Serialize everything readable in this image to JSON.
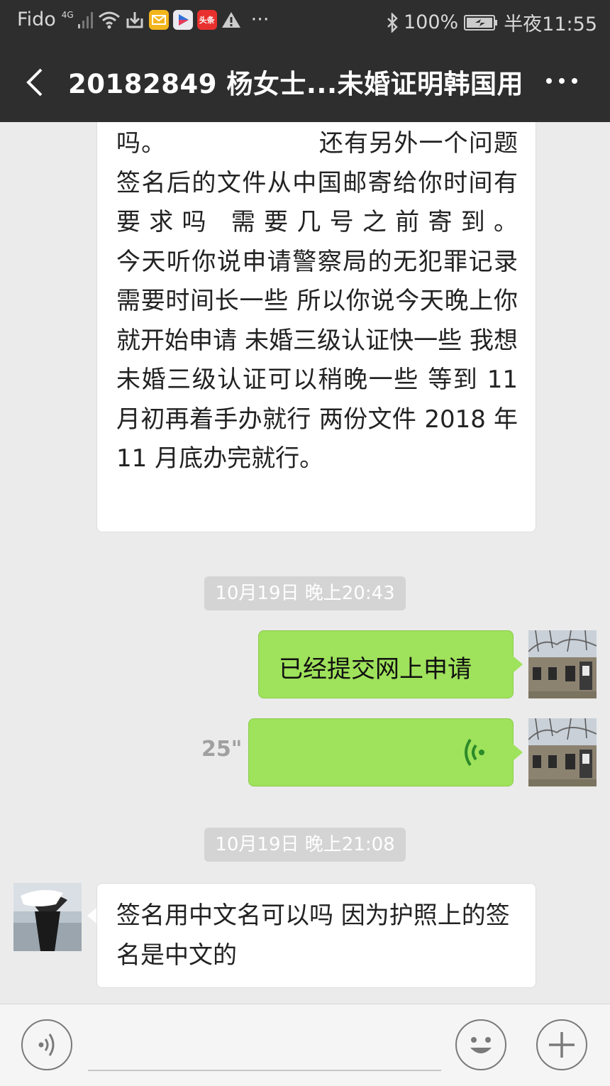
{
  "status_bar": {
    "carrier": "Fido",
    "network": "4G",
    "app_icons": [
      "wifi-icon",
      "download-icon",
      "mail-icon",
      "video-app-icon",
      "toutiao-app-icon",
      "warning-icon",
      "more-notifications"
    ],
    "toutiao_label": "头条",
    "dots": "···",
    "battery": "100%",
    "time": "半夜11:55"
  },
  "header": {
    "title": "20182849 杨女士...未婚证明韩国用"
  },
  "messages": [
    {
      "type": "text",
      "side": "left",
      "text": "吗。                  还有另外一个问题 签名后的文件从中国邮寄给你时间有要求吗 需要几号之前寄到。                  今天听你说申请警察局的无犯罪记录需要时间长一些 所以你说今天晚上你就开始申请 未婚三级认证快一些 我想未婚三级认证可以稍晚一些 等到 11 月初再着手办就行 两份文件 2018 年 11 月底办完就行。"
    },
    {
      "type": "timestamp",
      "text": "10月19日 晚上20:43"
    },
    {
      "type": "text",
      "side": "right",
      "text": "已经提交网上申请"
    },
    {
      "type": "voice",
      "side": "right",
      "duration": "25\""
    },
    {
      "type": "timestamp",
      "text": "10月19日 晚上21:08"
    },
    {
      "type": "text",
      "side": "left",
      "text": "签名用中文名可以吗 因为护照上的签名是中文的"
    }
  ],
  "colors": {
    "header_bg": "#2e2e2e",
    "chat_bg": "#ebebeb",
    "bubble_sent": "#9fe25b",
    "bubble_received": "#ffffff",
    "timestamp_bg": "#d4d4d4"
  }
}
